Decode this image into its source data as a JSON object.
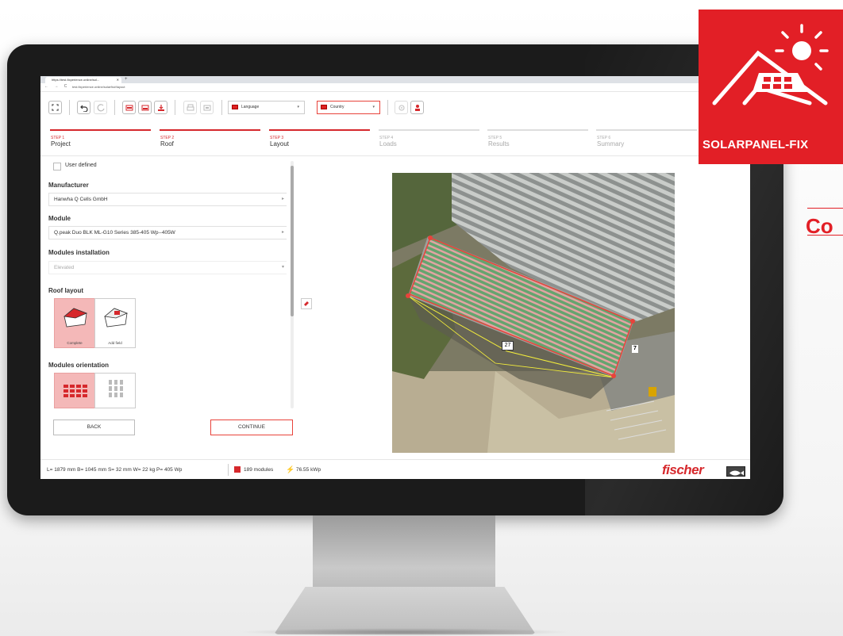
{
  "browser": {
    "tab_title": "https://test.fixperience.online/sol...",
    "tab_close": "✕",
    "new_tab": "+",
    "nav": "← → C",
    "url": "test.fixperience.online/solarfix#/layout"
  },
  "toolbar": {
    "language_label": "Language",
    "country_label": "Country",
    "caret": "▾"
  },
  "steps": [
    {
      "num": "STEP 1",
      "name": "Project"
    },
    {
      "num": "STEP 2",
      "name": "Roof"
    },
    {
      "num": "STEP 3",
      "name": "Layout"
    },
    {
      "num": "STEP 4",
      "name": "Loads"
    },
    {
      "num": "STEP 5",
      "name": "Results"
    },
    {
      "num": "STEP 6",
      "name": "Summary"
    }
  ],
  "form": {
    "user_defined": "User defined",
    "manufacturer_title": "Manufacturer",
    "manufacturer_value": "Hanwha Q Cells GmbH",
    "module_title": "Module",
    "module_value": "Q.peak Duo BLK ML-G10 Series 385-405 Wp--405W",
    "installation_title": "Modules installation",
    "installation_value": "Elevated",
    "roof_layout_title": "Roof layout",
    "roof_layout_options": [
      "Complete",
      "Add field"
    ],
    "orientation_title": "Modules orientation",
    "arrow": "▸",
    "arrow_down": "▾"
  },
  "buttons": {
    "back": "BACK",
    "continue": "CONTINUE"
  },
  "map": {
    "label_27": "27",
    "label_7": "7"
  },
  "status": {
    "dims": "L= 1879 mm  B= 1045 mm  S= 32 mm  W= 22 kg  P= 405 Wp",
    "modules": "189 modules",
    "power": "76.55 kWp",
    "brand": "fischer"
  },
  "badge": {
    "text": "SOLARPANEL-FIX"
  },
  "heading_fragment": "Co",
  "colors": {
    "accent": "#d6282c",
    "badge": "#e21f26"
  }
}
